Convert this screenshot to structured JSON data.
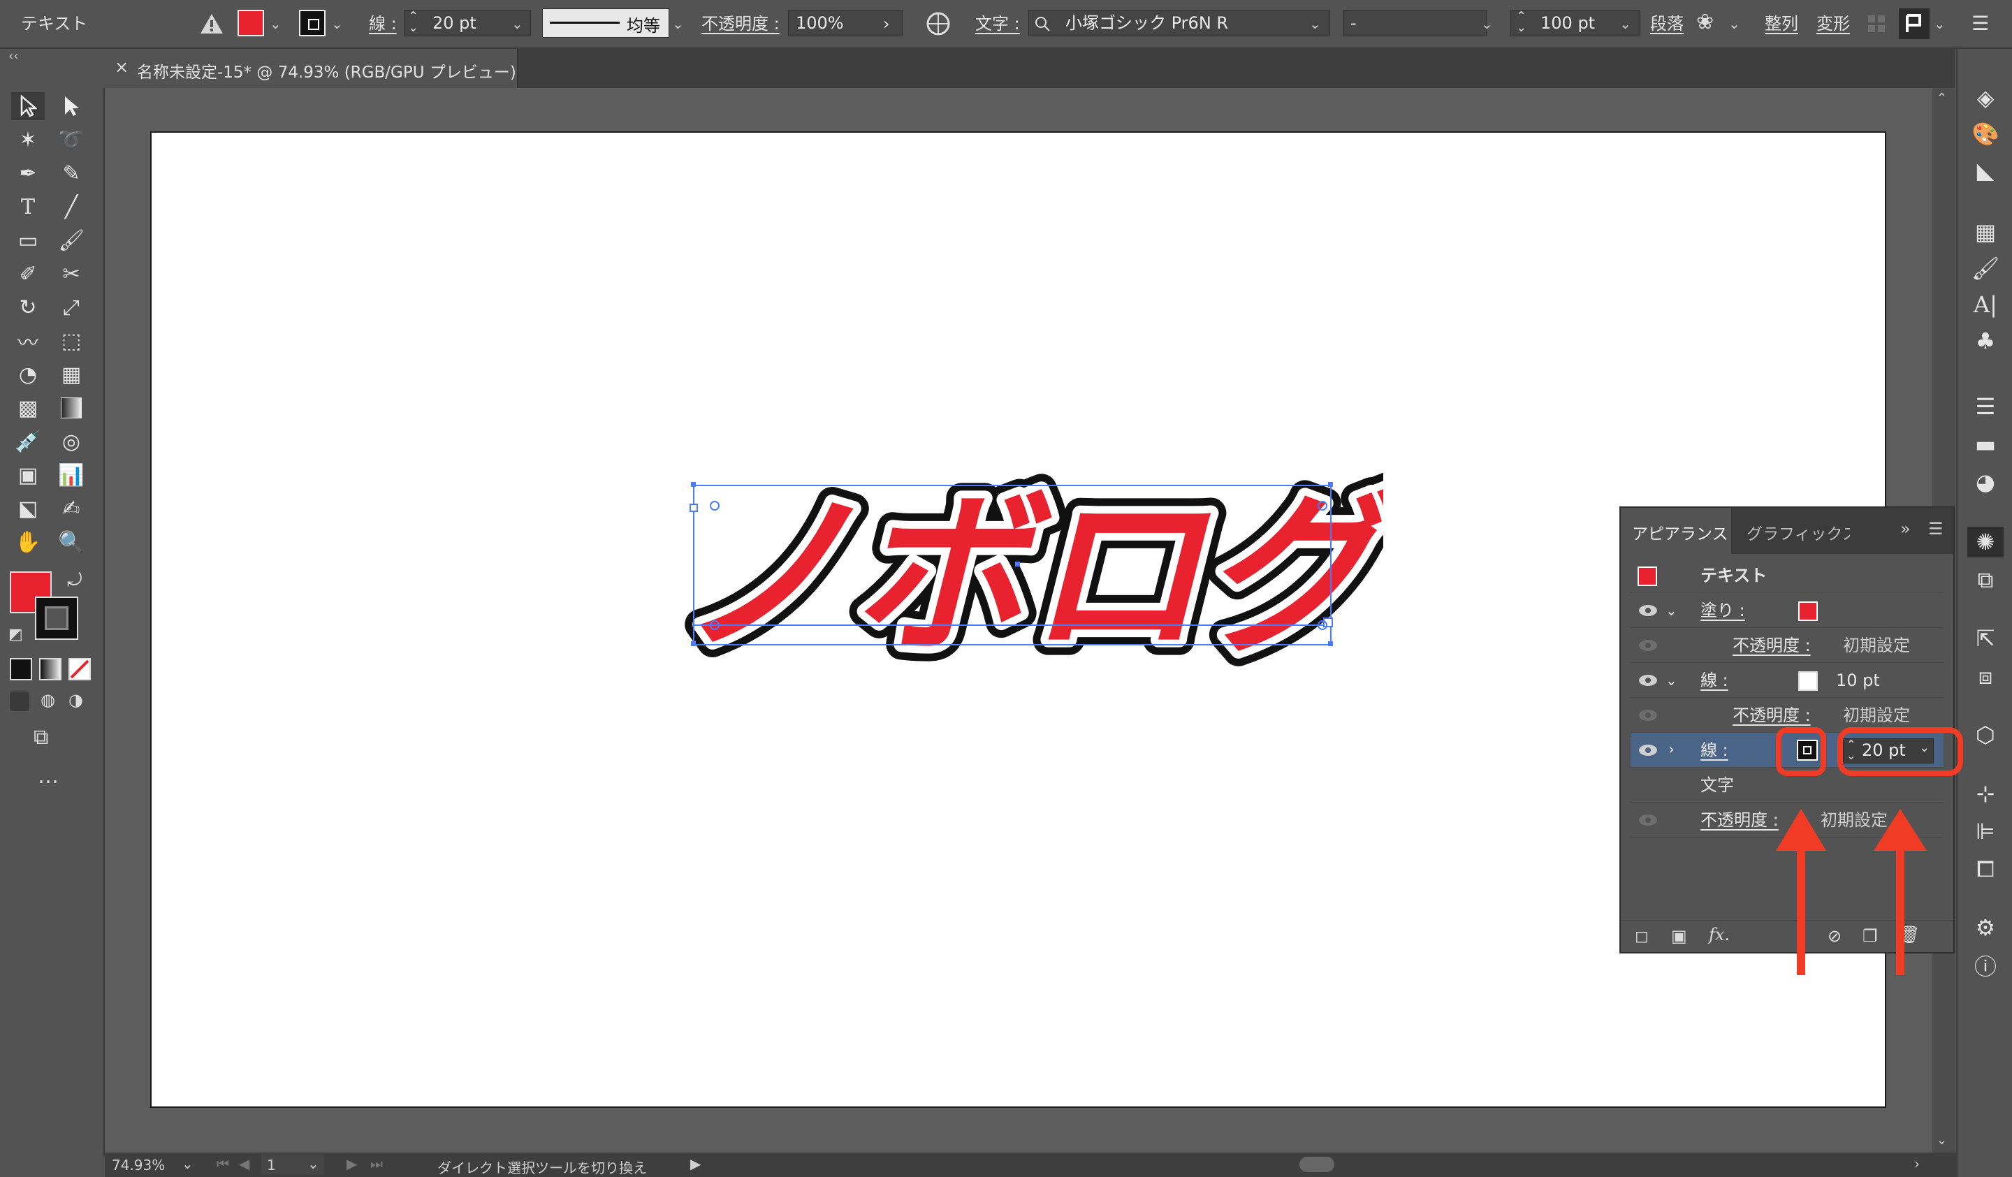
{
  "control_bar": {
    "object_type": "テキスト",
    "stroke_label": "線 :",
    "stroke_weight": "20 pt",
    "stroke_profile": "均等",
    "opacity_label": "不透明度 :",
    "opacity_value": "100%",
    "char_label": "文字 :",
    "font_family": "小塚ゴシック Pr6N R",
    "font_style": "-",
    "font_size": "100 pt",
    "paragraph_label": "段落",
    "align_label": "整列",
    "transform_label": "変形"
  },
  "document": {
    "tab_title": "名称未設定-15* @ 74.93% (RGB/GPU プレビュー)",
    "artwork_text": "ノボログ"
  },
  "status_bar": {
    "zoom": "74.93%",
    "artboard_number": "1",
    "message": "ダイレクト選択ツールを切り換え"
  },
  "appearance_panel": {
    "tab_active": "アピアランス",
    "tab_inactive": "グラフィックスタ",
    "header": "テキスト",
    "rows": [
      {
        "label": "塗り :",
        "value": ""
      },
      {
        "label": "不透明度 :",
        "value": "初期設定"
      },
      {
        "label": "線 :",
        "value": "10 pt"
      },
      {
        "label": "不透明度 :",
        "value": "初期設定"
      },
      {
        "label": "線 :",
        "value": "20 pt"
      },
      {
        "label": "文字",
        "value": ""
      },
      {
        "label": "不透明度 :",
        "value": "初期設定"
      }
    ]
  },
  "colors": {
    "fill_red": "#e8222e",
    "highlight": "#f03c24",
    "selection_blue": "#4b7bff",
    "ui_gray": "#535353"
  },
  "icons": [
    "warning-icon",
    "chevron-down-icon",
    "grid-icon",
    "search-icon",
    "layers-icon",
    "brush-icon",
    "info-icon"
  ]
}
